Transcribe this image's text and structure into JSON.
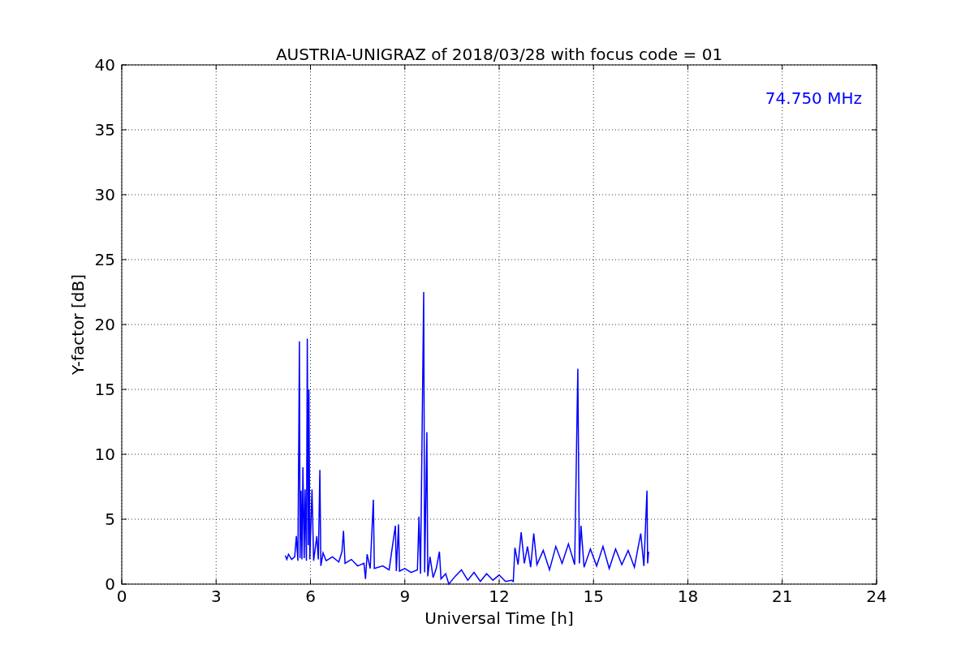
{
  "chart_data": {
    "type": "line",
    "title": "AUSTRIA-UNIGRAZ of 2018/03/28 with focus code = 01",
    "xlabel": "Universal Time [h]",
    "ylabel": "Y-factor [dB]",
    "xlim": [
      0,
      24
    ],
    "ylim": [
      0,
      40
    ],
    "grid": true,
    "xticks": [
      0,
      3,
      6,
      9,
      12,
      15,
      18,
      21,
      24
    ],
    "yticks": [
      0,
      5,
      10,
      15,
      20,
      25,
      30,
      35,
      40
    ],
    "x": [
      5.2,
      5.25,
      5.3,
      5.4,
      5.5,
      5.55,
      5.6,
      5.63,
      5.65,
      5.67,
      5.7,
      5.73,
      5.76,
      5.8,
      5.83,
      5.87,
      5.9,
      5.93,
      5.95,
      5.98,
      6.05,
      6.1,
      6.2,
      6.25,
      6.3,
      6.33,
      6.4,
      6.5,
      6.7,
      6.9,
      7.0,
      7.05,
      7.1,
      7.3,
      7.5,
      7.7,
      7.75,
      7.8,
      7.9,
      8.0,
      8.03,
      8.3,
      8.5,
      8.7,
      8.73,
      8.8,
      8.83,
      9.0,
      9.2,
      9.4,
      9.45,
      9.5,
      9.6,
      9.63,
      9.7,
      9.73,
      9.8,
      9.9,
      10.0,
      10.1,
      10.15,
      10.3,
      10.4,
      10.6,
      10.8,
      11.0,
      11.2,
      11.4,
      11.6,
      11.8,
      12.0,
      12.2,
      12.4,
      12.45,
      12.5,
      12.6,
      12.7,
      12.8,
      12.9,
      13.0,
      13.1,
      13.2,
      13.4,
      13.6,
      13.8,
      14.0,
      14.2,
      14.4,
      14.5,
      14.55,
      14.6,
      14.7,
      14.9,
      15.1,
      15.3,
      15.5,
      15.7,
      15.9,
      16.1,
      16.3,
      16.5,
      16.6,
      16.7,
      16.72,
      16.75
    ],
    "series": [
      {
        "name": "74.750 MHz",
        "color": "#0000ff",
        "values": [
          2.2,
          1.9,
          2.3,
          1.9,
          2.1,
          3.7,
          1.8,
          12.1,
          18.7,
          2.0,
          7.2,
          1.9,
          9.0,
          2.0,
          7.3,
          1.8,
          18.9,
          3.0,
          15.0,
          1.9,
          7.3,
          1.8,
          3.7,
          1.9,
          8.8,
          1.4,
          2.4,
          1.8,
          2.1,
          1.7,
          2.5,
          4.1,
          1.6,
          1.9,
          1.4,
          1.6,
          0.4,
          2.3,
          1.2,
          6.5,
          1.2,
          1.4,
          1.1,
          4.5,
          1.0,
          4.6,
          1.0,
          1.2,
          0.9,
          1.1,
          5.2,
          0.8,
          22.5,
          0.9,
          11.7,
          0.6,
          2.1,
          0.5,
          1.2,
          2.5,
          0.4,
          0.8,
          0.0,
          0.6,
          1.1,
          0.3,
          0.9,
          0.2,
          0.8,
          0.3,
          0.7,
          0.2,
          0.3,
          0.2,
          2.8,
          1.5,
          4.0,
          1.6,
          2.9,
          1.3,
          3.9,
          1.5,
          2.6,
          1.1,
          2.9,
          1.6,
          3.1,
          1.5,
          16.6,
          1.6,
          4.5,
          1.3,
          2.7,
          1.4,
          2.9,
          1.2,
          2.7,
          1.5,
          2.6,
          1.3,
          3.9,
          1.4,
          7.2,
          1.6,
          2.5
        ]
      }
    ]
  }
}
